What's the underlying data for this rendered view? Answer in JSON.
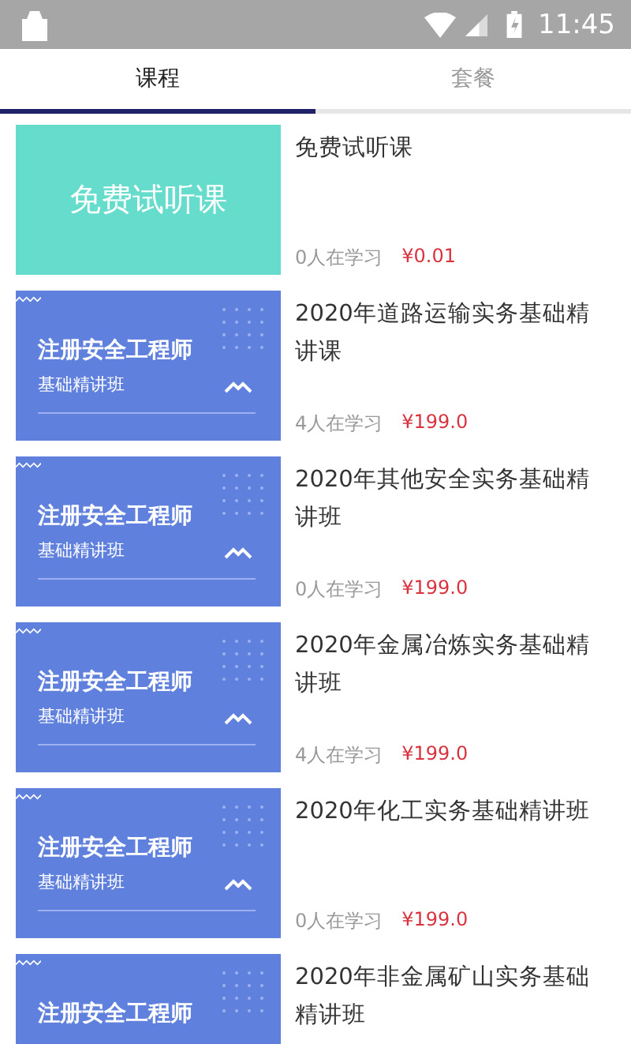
{
  "status_bar": {
    "time": "11:45"
  },
  "tabs": [
    {
      "label": "课程",
      "selected": true
    },
    {
      "label": "套餐",
      "selected": false
    }
  ],
  "courses": [
    {
      "thumb": {
        "kind": "free",
        "text": "免费试听课"
      },
      "title": "免费试听课",
      "learners": "0人在学习",
      "price": "¥0.01"
    },
    {
      "thumb": {
        "kind": "banner",
        "title": "注册安全工程师",
        "subtitle": "基础精讲班"
      },
      "title": "2020年道路运输实务基础精讲课",
      "learners": "4人在学习",
      "price": "¥199.0"
    },
    {
      "thumb": {
        "kind": "banner",
        "title": "注册安全工程师",
        "subtitle": "基础精讲班"
      },
      "title": "2020年其他安全实务基础精讲班",
      "learners": "0人在学习",
      "price": "¥199.0"
    },
    {
      "thumb": {
        "kind": "banner",
        "title": "注册安全工程师",
        "subtitle": "基础精讲班"
      },
      "title": "2020年金属冶炼实务基础精讲班",
      "learners": "4人在学习",
      "price": "¥199.0"
    },
    {
      "thumb": {
        "kind": "banner",
        "title": "注册安全工程师",
        "subtitle": "基础精讲班"
      },
      "title": "2020年化工实务基础精讲班",
      "learners": "0人在学习",
      "price": "¥199.0"
    },
    {
      "thumb": {
        "kind": "banner",
        "title": "注册安全工程师"
      },
      "title": "2020年非金属矿山实务基础精讲班"
    }
  ]
}
